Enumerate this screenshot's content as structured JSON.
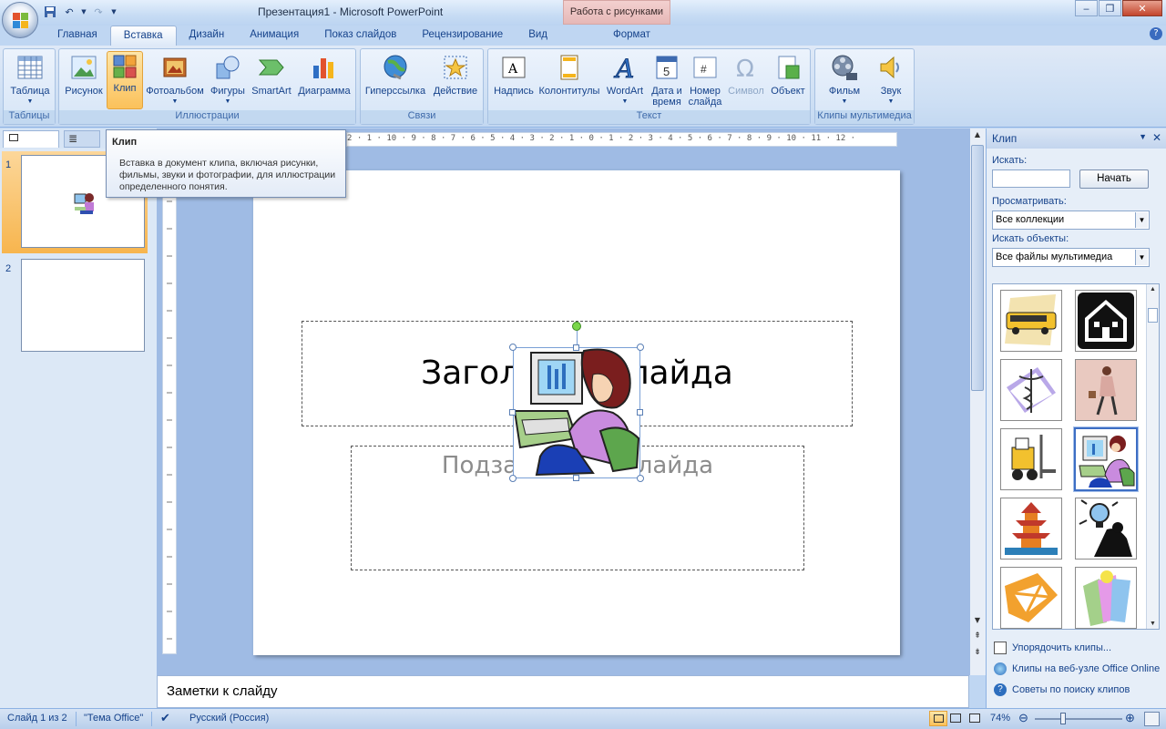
{
  "window": {
    "title": "Презентация1 - Microsoft PowerPoint",
    "context_tab_group": "Работа с рисунками"
  },
  "tabs": [
    {
      "label": "Главная"
    },
    {
      "label": "Вставка"
    },
    {
      "label": "Дизайн"
    },
    {
      "label": "Анимация"
    },
    {
      "label": "Показ слайдов"
    },
    {
      "label": "Рецензирование"
    },
    {
      "label": "Вид"
    },
    {
      "label": "Формат"
    }
  ],
  "ribbon": {
    "groups": {
      "tables": "Таблицы",
      "illustrations": "Иллюстрации",
      "links": "Связи",
      "text": "Текст",
      "media": "Клипы мультимедиа"
    },
    "buttons": {
      "table": "Таблица",
      "picture": "Рисунок",
      "clip": "Клип",
      "photoalbum": "Фотоальбом",
      "shapes": "Фигуры",
      "smartart": "SmartArt",
      "chart": "Диаграмма",
      "hyperlink": "Гиперссылка",
      "action": "Действие",
      "textbox": "Надпись",
      "headerfooter": "Колонтитулы",
      "wordart": "WordArt",
      "datetime_1": "Дата и",
      "datetime_2": "время",
      "slidenum_1": "Номер",
      "slidenum_2": "слайда",
      "symbol": "Символ",
      "object": "Объект",
      "movie": "Фильм",
      "sound": "Звук"
    }
  },
  "tooltip": {
    "title": "Клип",
    "body": "Вставка в документ клипа, включая рисунки, фильмы, звуки и фотографии, для иллюстрации определенного понятия."
  },
  "slides_pane": {
    "thumbs": [
      {
        "num": "1"
      },
      {
        "num": "2"
      }
    ]
  },
  "ruler": {
    "text": "2 · 1 · 10 · 9 · 8 · 7 · 6 · 5 · 4 · 3 · 2 · 1 · 0 · 1 · 2 · 3 · 4 · 5 · 6 · 7 · 8 · 9 · 10 · 11 · 12 ·"
  },
  "slide": {
    "title_placeholder": "Заголовок слайда",
    "subtitle_placeholder": "Подзаголовок слайда"
  },
  "notes": {
    "placeholder": "Заметки к слайду"
  },
  "task_pane": {
    "title": "Клип",
    "search_label": "Искать:",
    "search_value": "",
    "go_button": "Начать",
    "browse_label": "Просматривать:",
    "browse_value": "Все коллекции",
    "types_label": "Искать объекты:",
    "types_value": "Все файлы мультимедиа",
    "links": {
      "organize": "Упорядочить клипы...",
      "online": "Клипы на веб-узле Office Online",
      "tips": "Советы по поиску клипов"
    }
  },
  "status_bar": {
    "slide_info": "Слайд 1 из 2",
    "theme": "\"Тема Office\"",
    "language": "Русский (Россия)",
    "zoom": "74%"
  },
  "colors": {
    "accent": "#15428b",
    "ribbon_bg": "#cddff4",
    "selected_button": "#fbc15a",
    "context_tab": "#e6b8b7"
  }
}
